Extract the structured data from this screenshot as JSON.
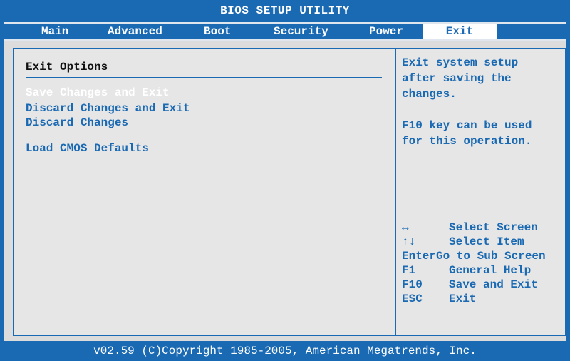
{
  "title": "BIOS SETUP UTILITY",
  "tabs": [
    {
      "label": "Main"
    },
    {
      "label": "Advanced"
    },
    {
      "label": "Boot"
    },
    {
      "label": "Security"
    },
    {
      "label": "Power"
    },
    {
      "label": "Exit",
      "active": true
    }
  ],
  "exit": {
    "section_title": "Exit Options",
    "options": [
      {
        "label": "Save Changes and Exit",
        "selected": true
      },
      {
        "label": "Discard Changes and Exit"
      },
      {
        "label": "Discard Changes"
      },
      {
        "label": "Load CMOS Defaults"
      }
    ]
  },
  "help": {
    "description": "Exit system setup\nafter saving the\nchanges.",
    "note": "F10 key can be used\nfor this operation."
  },
  "keys": [
    {
      "key": "↔",
      "desc": "Select Screen"
    },
    {
      "key": "↑↓",
      "desc": "Select Item"
    },
    {
      "key": "Enter",
      "desc": "Go to Sub Screen"
    },
    {
      "key": "F1",
      "desc": "General Help"
    },
    {
      "key": "F10",
      "desc": "Save and Exit"
    },
    {
      "key": "ESC",
      "desc": "Exit"
    }
  ],
  "footer": "v02.59 (C)Copyright 1985-2005, American Megatrends, Inc.",
  "colors": {
    "bios_blue": "#1a69b3",
    "panel_gray": "#e6e6e6",
    "selected_text": "#ffffff"
  }
}
